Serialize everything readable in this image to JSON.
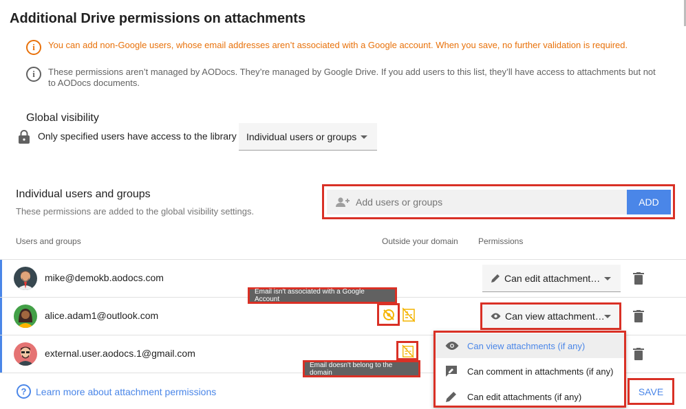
{
  "page": {
    "title": "Additional Drive permissions on attachments"
  },
  "notices": {
    "warning": "You can add non-Google users, whose email addresses aren’t associated with a Google account. When you save, no further validation is required.",
    "info": "These permissions aren’t managed by AODocs. They’re managed by Google Drive. If you add users to this list, they’ll have access to attachments but not to AODocs documents."
  },
  "global_visibility": {
    "title": "Global visibility",
    "text": "Only specified users have access to the library",
    "select_value": "Individual users or groups"
  },
  "individual": {
    "title": "Individual users and groups",
    "subtitle": "These permissions are added to the global visibility settings.",
    "add_placeholder": "Add users or groups",
    "add_button": "ADD"
  },
  "table": {
    "headers": {
      "users": "Users and groups",
      "outside": "Outside your domain",
      "permissions": "Permissions"
    },
    "rows": [
      {
        "email": "mike@demokb.aodocs.com",
        "permission": "Can edit attachment…"
      },
      {
        "email": "alice.adam1@outlook.com",
        "permission": "Can view attachment…"
      },
      {
        "email": "external.user.aodocs.1@gmail.com",
        "permission": ""
      }
    ]
  },
  "tooltips": {
    "no_google_account": "Email isn't associated with a Google Account",
    "outside_domain": "Email doesn't belong to the domain"
  },
  "permission_menu": {
    "items": [
      {
        "label": "Can view attachments (if any)",
        "icon": "eye-icon",
        "selected": true
      },
      {
        "label": "Can comment in attachments (if any)",
        "icon": "comment-icon",
        "selected": false
      },
      {
        "label": "Can edit attachments (if any)",
        "icon": "pencil-icon",
        "selected": false
      }
    ]
  },
  "footer": {
    "learn_more": "Learn more about attachment permissions",
    "save": "SAVE"
  },
  "colors": {
    "accent": "#4a86e8",
    "warning": "#e8710a",
    "highlight_border": "#d93025",
    "outside_domain_icon": "#f4b400"
  }
}
